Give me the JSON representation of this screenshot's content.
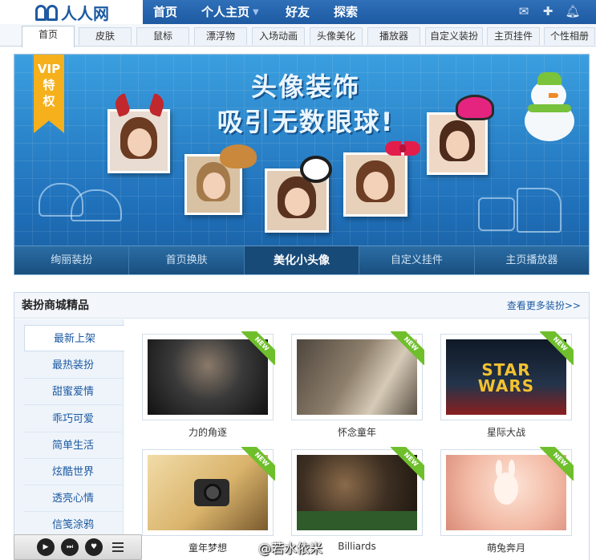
{
  "brand": {
    "logo_text": "人人网"
  },
  "topnav": {
    "links": [
      "首页",
      "个人主页",
      "好友",
      "探索"
    ],
    "icons": [
      "message-icon",
      "add-friend-icon",
      "notification-bell-icon"
    ]
  },
  "subtabs": [
    "首页",
    "皮肤",
    "鼠标",
    "漂浮物",
    "入场动画",
    "头像美化",
    "播放器",
    "自定义装扮",
    "主页挂件",
    "个性相册"
  ],
  "banner": {
    "vip_text": "VIP特权",
    "vip_line1": "VIP",
    "vip_line2": "特",
    "vip_line3": "权",
    "title_line1": "头像装饰",
    "title_line2": "吸引无数眼球!",
    "menu": [
      "绚丽装扮",
      "首页换肤",
      "美化小头像",
      "自定义挂件",
      "主页播放器"
    ],
    "active_menu": "美化小头像"
  },
  "shop": {
    "title": "装扮商城精品",
    "more_link": "查看更多装扮>>",
    "categories": [
      "最新上架",
      "最热装扮",
      "甜蜜爱情",
      "乖巧可爱",
      "简单生活",
      "炫酷世界",
      "透亮心情",
      "信笺涂鸦"
    ],
    "badge_text": "NEW",
    "products": [
      {
        "name": "力的角逐",
        "color": "#3a3a3a"
      },
      {
        "name": "怀念童年",
        "color": "#5b5146"
      },
      {
        "name": "星际大战",
        "color": "#1f2a3a"
      },
      {
        "name": "童年梦想",
        "color": "#d9b36b"
      },
      {
        "name": "Billiards",
        "color": "#2b2218"
      },
      {
        "name": "萌兔奔月",
        "color": "#f2b9a4"
      }
    ]
  },
  "player": {
    "buttons": [
      "play-icon",
      "next-icon",
      "like-icon",
      "playlist-icon"
    ]
  },
  "watermark": "@若水依米"
}
